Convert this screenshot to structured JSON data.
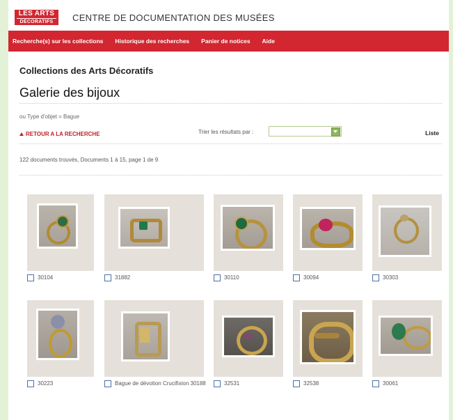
{
  "header": {
    "logo_line1": "LES ARTS",
    "logo_line2": "DÉCORATIFS",
    "site_title": "CENTRE DE DOCUMENTATION DES MUSÉES"
  },
  "nav": {
    "items": [
      "Recherche(s) sur les collections",
      "Historique des recherches",
      "Panier de notices",
      "Aide"
    ]
  },
  "collection_title": "Collections des Arts Décoratifs",
  "gallery_title": "Galerie des bijoux",
  "criteria": "ou Type d'objet = Bague",
  "toolbar": {
    "back_label": "RETOUR A LA RECHERCHE",
    "sort_label": "Trier les résultats par :",
    "sort_value": "",
    "list_label": "Liste"
  },
  "results_text": "122 documents trouvés, Documents 1 à 15, page 1 de 9",
  "items": [
    {
      "caption": "30104"
    },
    {
      "caption": "31882"
    },
    {
      "caption": "30110"
    },
    {
      "caption": "30094"
    },
    {
      "caption": "30303"
    },
    {
      "caption": "30223"
    },
    {
      "caption": "Bague de dévotion Crucifixion 30188"
    },
    {
      "caption": "32531"
    },
    {
      "caption": "32538"
    },
    {
      "caption": "30061"
    }
  ]
}
